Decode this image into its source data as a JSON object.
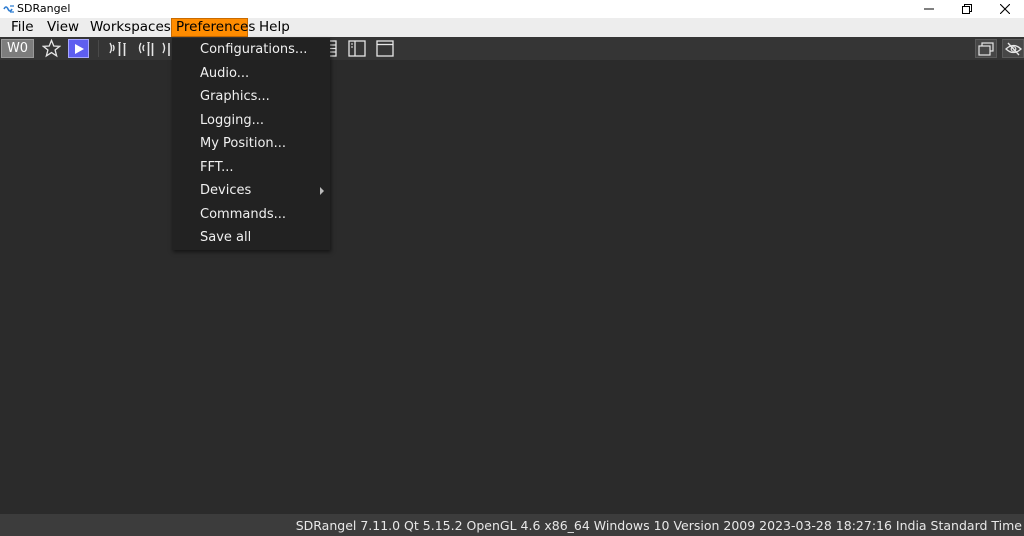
{
  "window": {
    "title": "SDRangel",
    "minimize_icon": "minimize-icon",
    "restore_icon": "restore-icon",
    "close_icon": "close-icon"
  },
  "menubar": {
    "items": [
      {
        "label": "File"
      },
      {
        "label": "View"
      },
      {
        "label": "Workspaces"
      },
      {
        "label": "Preferences"
      },
      {
        "label": "Help"
      }
    ],
    "active": "Preferences",
    "accent_color": "#ff8c00"
  },
  "toolbar": {
    "workspace_label": "W0",
    "icons": [
      "star-icon",
      "play-icon",
      "rx-antenna-icon",
      "tx-antenna-icon",
      "mimo-antenna-icon",
      "list-icon",
      "panel-split-icon",
      "window-icon",
      "windows-stack-icon",
      "hidden-eye-icon"
    ]
  },
  "preferences_menu": {
    "items": [
      {
        "label": "Configurations..."
      },
      {
        "label": "Audio..."
      },
      {
        "label": "Graphics..."
      },
      {
        "label": "Logging..."
      },
      {
        "label": "My Position..."
      },
      {
        "label": "FFT..."
      },
      {
        "label": "Devices",
        "has_submenu": true
      },
      {
        "label": "Commands..."
      },
      {
        "label": "Save all"
      }
    ]
  },
  "statusbar": {
    "text": "SDRangel 7.11.0 Qt 5.15.2 OpenGL 4.6 x86_64 Windows 10 Version 2009  2023-03-28 18:27:16 India Standard Time"
  }
}
